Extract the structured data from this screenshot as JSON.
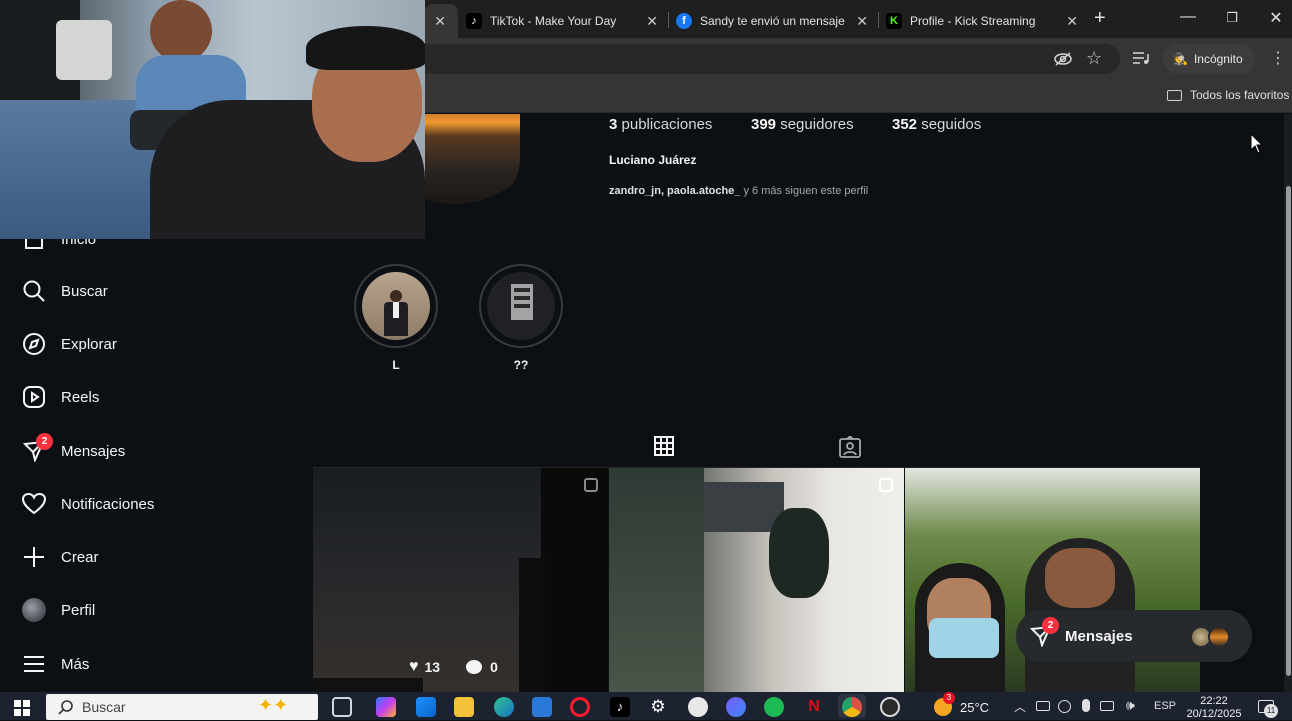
{
  "browser": {
    "tabs": [
      {
        "title": "TikTok - Make Your Day",
        "icon": "tiktok-icon"
      },
      {
        "title": "Sandy te envió un mensaje",
        "icon": "facebook-icon"
      },
      {
        "title": "Profile - Kick Streaming",
        "icon": "kick-icon"
      }
    ],
    "incognito_label": "Incógnito",
    "bookmarks_folder": "Todos los favoritos"
  },
  "profile": {
    "publications_count": "3",
    "publications_label": "publicaciones",
    "followers_count": "399",
    "followers_label": "seguidores",
    "following_count": "352",
    "following_label": "seguidos",
    "full_name": "Luciano Juárez",
    "followed_by_users": "zandro_jn, paola.atoche_",
    "followed_by_rest": " y 6 más siguen este perfil"
  },
  "highlights": [
    {
      "label": "L"
    },
    {
      "label": "??"
    }
  ],
  "sidebar": {
    "items": [
      {
        "label": "Inicio",
        "icon": "home-icon"
      },
      {
        "label": "Buscar",
        "icon": "search-icon"
      },
      {
        "label": "Explorar",
        "icon": "compass-icon"
      },
      {
        "label": "Reels",
        "icon": "reels-icon"
      },
      {
        "label": "Mensajes",
        "icon": "messenger-icon",
        "badge": "2"
      },
      {
        "label": "Notificaciones",
        "icon": "heart-icon"
      },
      {
        "label": "Crear",
        "icon": "plus-icon"
      },
      {
        "label": "Perfil",
        "icon": "avatar-icon"
      },
      {
        "label": "Más",
        "icon": "menu-icon"
      }
    ]
  },
  "posts": [
    {
      "likes": "13",
      "comments": "0"
    }
  ],
  "messages_popup": {
    "label": "Mensajes",
    "badge": "2"
  },
  "taskbar": {
    "search_placeholder": "Buscar",
    "weather_temp": "25°C",
    "weather_badge": "3",
    "language": "ESP",
    "time": "22:22",
    "date": "20/12/2025",
    "notification_count": "11"
  },
  "colors": {
    "page_bg": "#0c1014",
    "badge_red": "#ff3040",
    "chrome_dark": "#1f1f1f",
    "chrome_toolbar": "#353535",
    "taskbar": "#1c2230"
  }
}
